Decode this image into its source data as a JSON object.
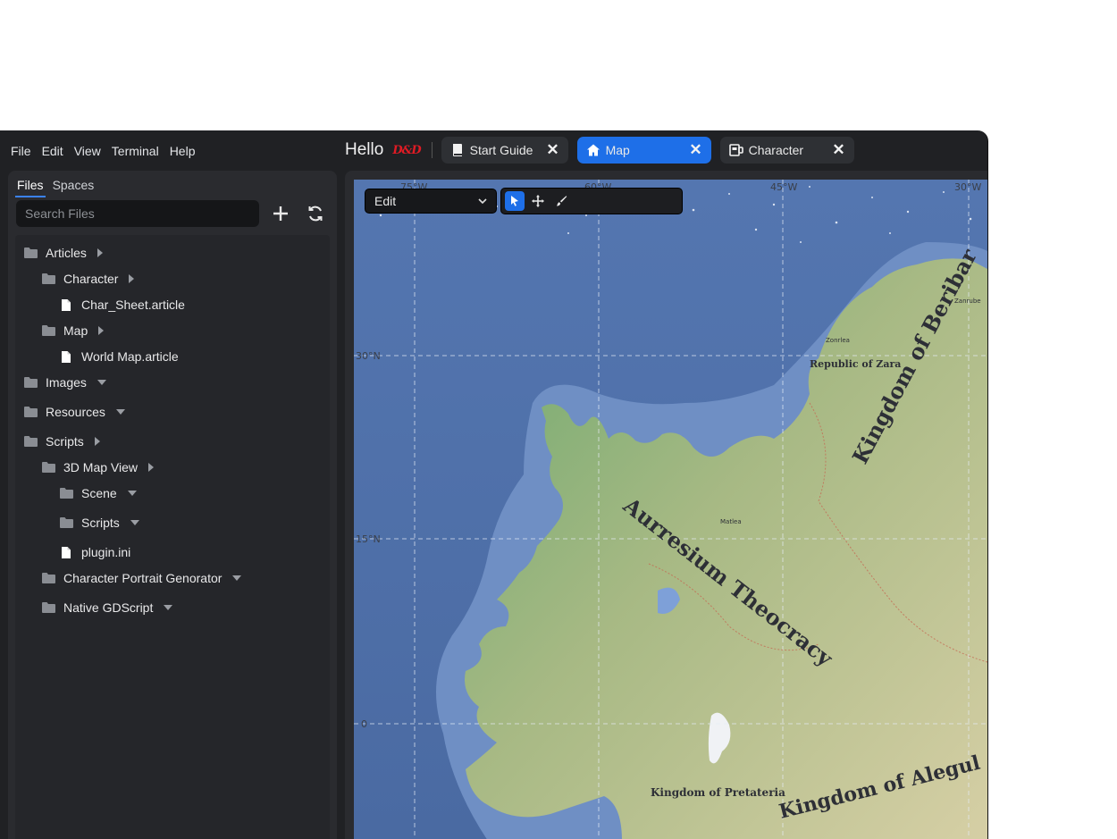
{
  "menubar": {
    "items": [
      "File",
      "Edit",
      "View",
      "Terminal",
      "Help"
    ]
  },
  "header": {
    "title": "Hello",
    "logo_text": "D&D"
  },
  "tabs": [
    {
      "label": "Start Guide",
      "icon": "book-icon",
      "active": false
    },
    {
      "label": "Map",
      "icon": "home-icon",
      "active": true
    },
    {
      "label": "Character",
      "icon": "card-icon",
      "active": false
    }
  ],
  "sidebar": {
    "subtabs": [
      "Files",
      "Spaces"
    ],
    "search_placeholder": "Search Files",
    "tree": [
      {
        "label": "Articles",
        "type": "folder",
        "depth": 0,
        "expand": "collapsed"
      },
      {
        "label": "Character",
        "type": "folder",
        "depth": 1,
        "expand": "collapsed"
      },
      {
        "label": "Char_Sheet.article",
        "type": "file",
        "depth": 2
      },
      {
        "label": "Map",
        "type": "folder",
        "depth": 1,
        "expand": "collapsed"
      },
      {
        "label": "World Map.article",
        "type": "file",
        "depth": 2
      },
      {
        "label": "Images",
        "type": "folder",
        "depth": 0,
        "expand": "expanded"
      },
      {
        "label": "Resources",
        "type": "folder",
        "depth": 0,
        "expand": "expanded"
      },
      {
        "label": "Scripts",
        "type": "folder",
        "depth": 0,
        "expand": "collapsed"
      },
      {
        "label": "3D Map View",
        "type": "folder",
        "depth": 1,
        "expand": "collapsed"
      },
      {
        "label": "Scene",
        "type": "folder",
        "depth": 2,
        "expand": "expanded"
      },
      {
        "label": "Scripts",
        "type": "folder",
        "depth": 2,
        "expand": "expanded"
      },
      {
        "label": "plugin.ini",
        "type": "file",
        "depth": 2
      },
      {
        "label": "Character Portrait Genorator",
        "type": "folder",
        "depth": 1,
        "expand": "expanded"
      },
      {
        "label": "Native GDScript",
        "type": "folder",
        "depth": 1,
        "expand": "expanded"
      }
    ]
  },
  "map_toolbar": {
    "mode_value": "Edit",
    "tools": [
      "select-arrow-icon",
      "move-icon",
      "brush-icon"
    ],
    "active_tool": 0
  },
  "map": {
    "lon_labels": [
      "75°W",
      "60°W",
      "45°W",
      "30°W"
    ],
    "lat_labels": [
      "30°N",
      "15°N",
      "0"
    ],
    "regions": [
      "Aurresium Theocracy",
      "Kingdom of Beribar",
      "Republic of Zara",
      "Kingdom of Pretateria",
      "Kingdom of Alegul"
    ],
    "cities": [
      "Zonrlea",
      "Matlea",
      "Zanrube"
    ]
  },
  "colors": {
    "accent": "#1e6fe8",
    "ocean": "#4d6ea8",
    "logo": "#e01b24"
  }
}
